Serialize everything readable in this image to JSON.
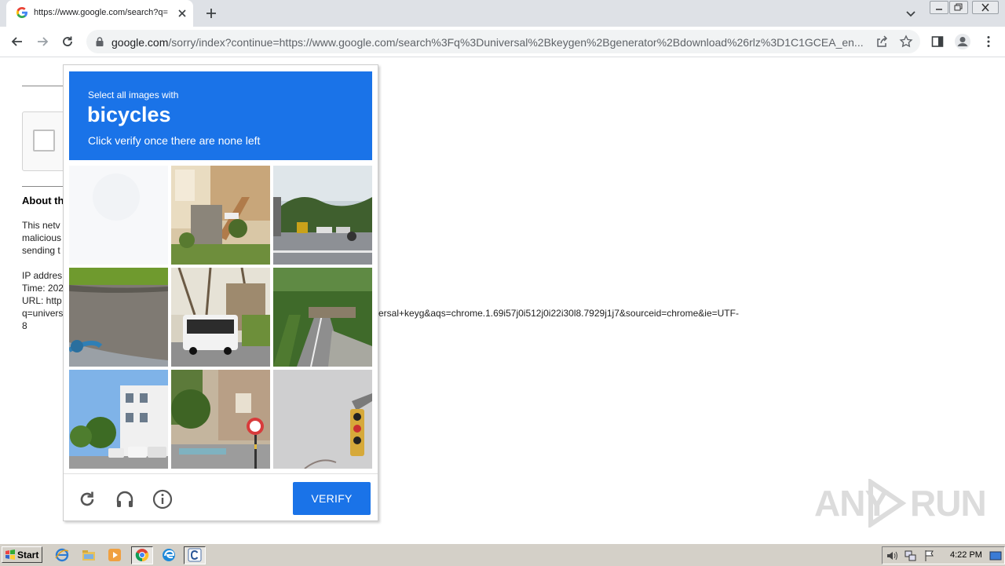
{
  "browser": {
    "tab_title": "https://www.google.com/search?q=",
    "url_host": "google.com",
    "url_path": "/sorry/index?continue=https://www.google.com/search%3Fq%3Duniversal%2Bkeygen%2Bgenerator%2Bdownload%26rlz%3D1C1GCEA_en..."
  },
  "page": {
    "about_title": "About th",
    "text_lines": [
      "This netv",
      "malicious",
      "sending t",
      "IP addres",
      "Time: 202",
      "URL: http",
      "q=univers",
      "8"
    ],
    "url_tail": "ersal+keyg&aqs=chrome.1.69i57j0i512j0i22i30l8.7929j1j7&sourceid=chrome&ie=UTF-"
  },
  "captcha": {
    "instruction_line1": "Select all images with",
    "target": "bicycles",
    "instruction_line3": "Click verify once there are none left",
    "verify_label": "VERIFY",
    "tiles": [
      {
        "name": "tile-1-blank"
      },
      {
        "name": "tile-2-building-stairs"
      },
      {
        "name": "tile-3-parking-lot"
      },
      {
        "name": "tile-4-road-curb"
      },
      {
        "name": "tile-5-bus"
      },
      {
        "name": "tile-6-road-bridge"
      },
      {
        "name": "tile-7-buildings-cars"
      },
      {
        "name": "tile-8-street-sign"
      },
      {
        "name": "tile-9-traffic-light"
      }
    ]
  },
  "watermark": {
    "left": "ANY",
    "right": "RUN"
  },
  "taskbar": {
    "start_label": "Start",
    "clock": "4:22 PM"
  },
  "colors": {
    "accent": "#1a73e8",
    "chrome_bg": "#dee1e6",
    "taskbar_bg": "#d4d0c8"
  }
}
